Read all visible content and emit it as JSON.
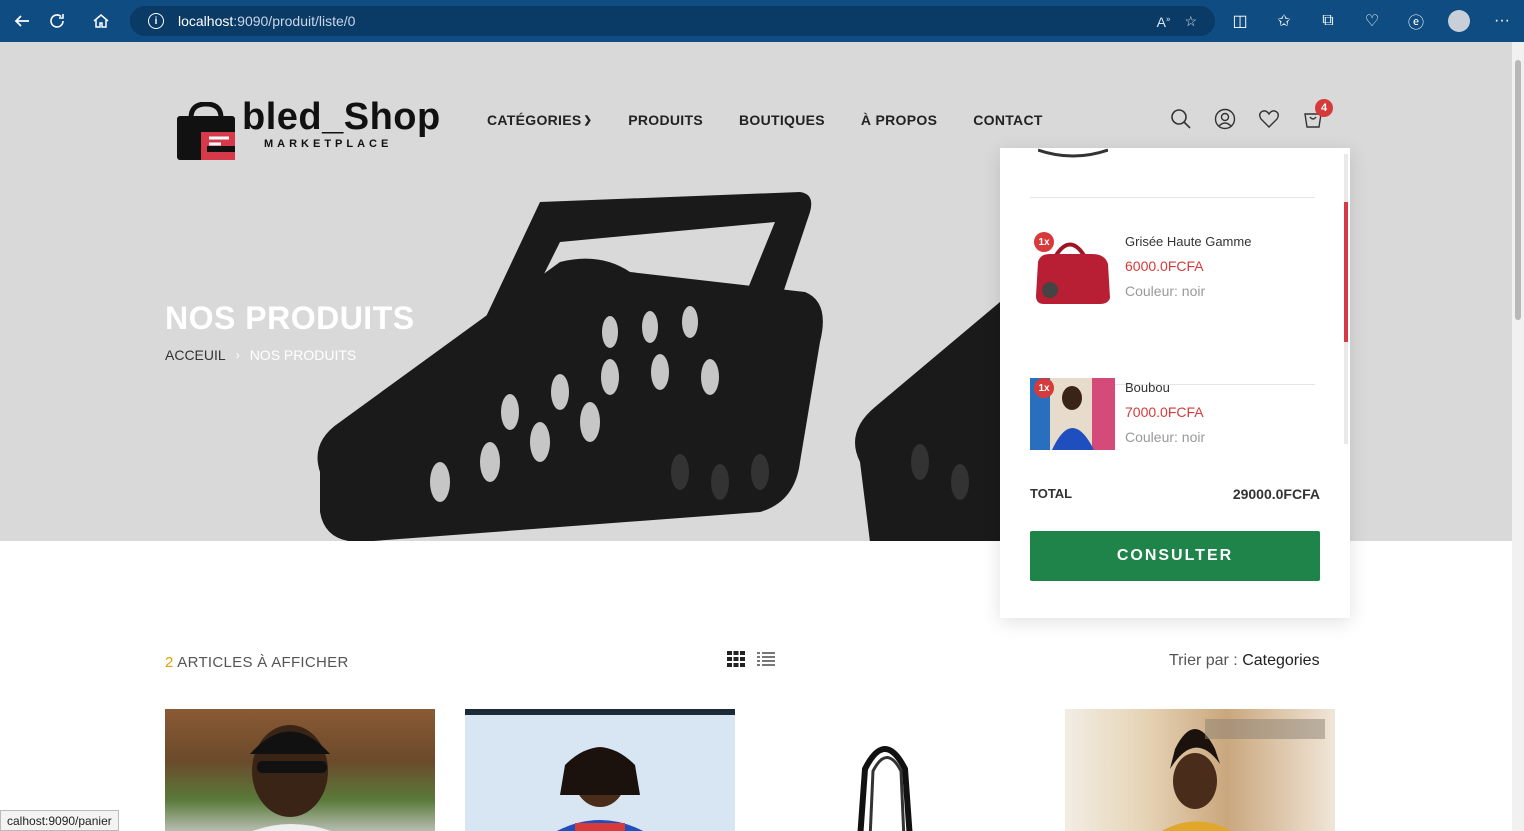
{
  "browser": {
    "url_host": "localhost",
    "url_path": ":9090/produit/liste/0",
    "status_url": "calhost:9090/panier"
  },
  "header": {
    "logo_text": "bled_Shop",
    "logo_sub": "MARKETPLACE",
    "nav": [
      {
        "label": "CATÉGORIES"
      },
      {
        "label": "PRODUITS"
      },
      {
        "label": "BOUTIQUES"
      },
      {
        "label": "À PROPOS"
      },
      {
        "label": "CONTACT"
      }
    ],
    "cart_count": "4",
    "colors": {
      "accent": "#d63a3a",
      "hero_bg": "#d9d9d9"
    }
  },
  "hero": {
    "title": "NOS PRODUITS",
    "breadcrumb_home": "ACCEUIL",
    "breadcrumb_sep": "›",
    "breadcrumb_current": "NOS PRODUITS"
  },
  "cart": {
    "items": [
      {
        "qty": "1x",
        "name": "Grisée Haute Gamme",
        "price": "6000.0FCFA",
        "color": "Couleur: noir"
      },
      {
        "qty": "1x",
        "name": "Boubou",
        "price": "7000.0FCFA",
        "color": "Couleur: noir"
      }
    ],
    "total_label": "TOTAL",
    "total_value": "29000.0FCFA",
    "button_label": "CONSULTER",
    "button_color": "#1e8449"
  },
  "listing": {
    "count": "2",
    "count_label": "ARTICLES À AFFICHER",
    "sort_label": "Trier par :",
    "sort_value": "Categories"
  }
}
